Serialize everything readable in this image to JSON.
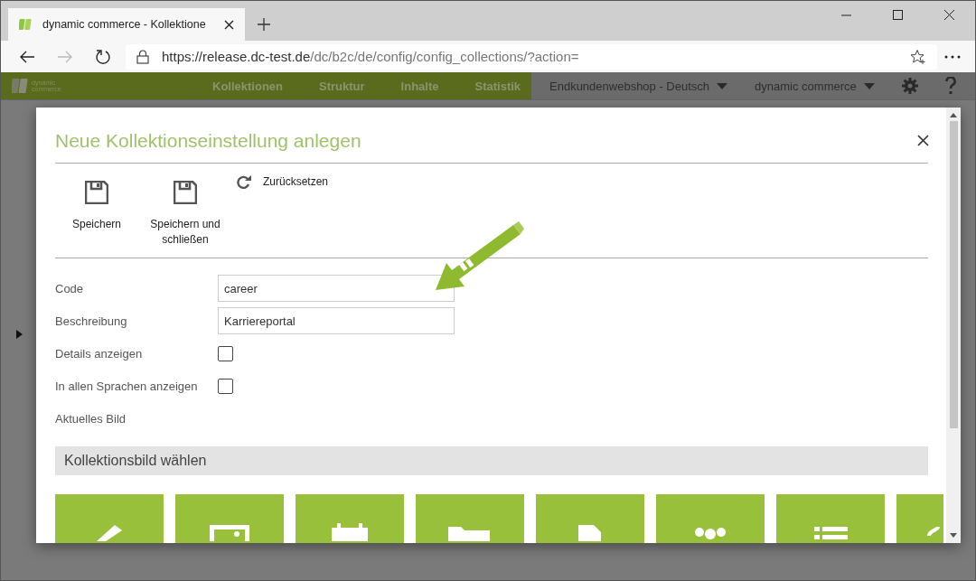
{
  "browser": {
    "tab_title": "dynamic commerce - Kollektione",
    "url_host": "https://release.dc-test.de",
    "url_path": "/dc/b2c/de/config/config_collections/?action="
  },
  "nav": {
    "logo_lines": [
      "dynamic",
      "commerce"
    ],
    "items": [
      "Kollektionen",
      "Struktur",
      "Inhalte",
      "Statistik"
    ],
    "dropdowns": [
      "Endkundenwebshop - Deutsch",
      "dynamic commerce"
    ]
  },
  "modal": {
    "title": "Neue Kollektionseinstellung anlegen",
    "toolbar": [
      {
        "label": "Speichern",
        "kind": "save"
      },
      {
        "label": "Speichern und schließen",
        "kind": "save"
      },
      {
        "label": "Zurücksetzen",
        "kind": "reset"
      }
    ],
    "fields": [
      {
        "label": "Code",
        "kind": "text",
        "value": "career"
      },
      {
        "label": "Beschreibung",
        "kind": "text",
        "value": "Karriereportal"
      },
      {
        "label": "Details anzeigen",
        "kind": "checkbox",
        "checked": false
      },
      {
        "label": "In allen Sprachen anzeigen",
        "kind": "checkbox",
        "checked": false
      },
      {
        "label": "Aktuelles Bild",
        "kind": "static"
      }
    ],
    "section_title": "Kollektionsbild wählen"
  }
}
